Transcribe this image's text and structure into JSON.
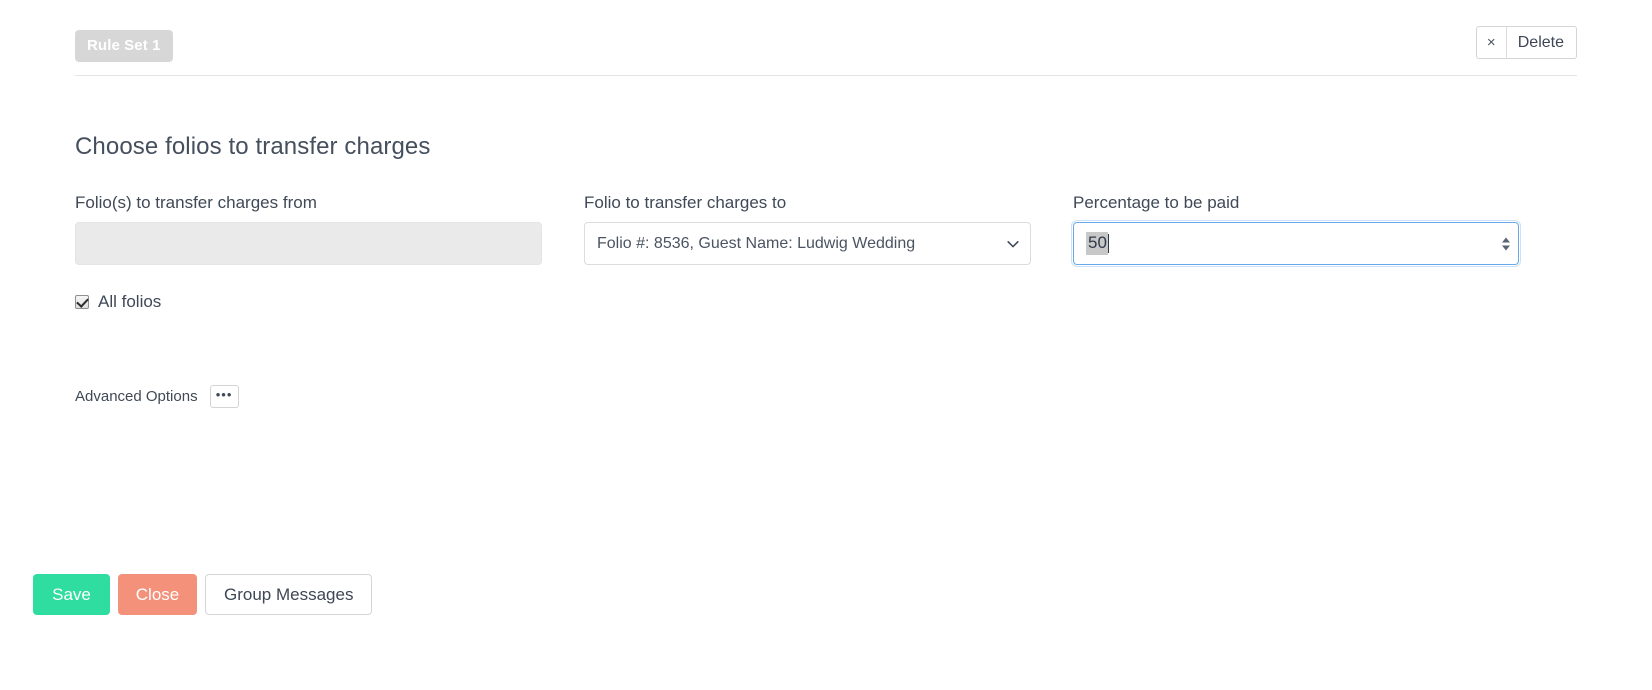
{
  "topbar": {
    "rule_badge": "Rule Set 1",
    "delete_close_icon": "×",
    "delete_label": "Delete"
  },
  "section": {
    "title": "Choose folios to transfer charges"
  },
  "form": {
    "from": {
      "label": "Folio(s) to transfer charges from",
      "value": "",
      "placeholder": "",
      "disabled": true
    },
    "to": {
      "label": "Folio to transfer charges to",
      "selected": "Folio #: 8536, Guest Name: Ludwig Wedding",
      "options": [
        "Folio #: 8536, Guest Name: Ludwig Wedding"
      ]
    },
    "percentage": {
      "label": "Percentage to be paid",
      "value": "50",
      "focused": true,
      "text_selected": true
    },
    "all_folios": {
      "label": "All folios",
      "checked": true
    }
  },
  "advanced": {
    "label": "Advanced Options",
    "ellipsis": "•••"
  },
  "footer": {
    "save_label": "Save",
    "close_label": "Close",
    "group_messages_label": "Group Messages"
  },
  "colors": {
    "badge_bg": "#d7d7d7",
    "save_bg": "#2edd9f",
    "close_bg": "#f4917a",
    "focus_border": "#6aa9e9",
    "disabled_bg": "#eaeaea",
    "text": "#3f4957"
  }
}
